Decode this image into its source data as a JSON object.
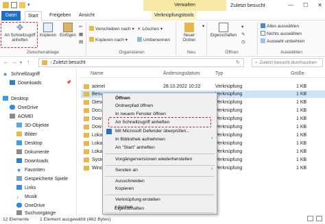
{
  "window": {
    "title": "Zuletzt besucht",
    "context_tab_group": "Verwalten",
    "controls": [
      "—",
      "☐",
      "✕"
    ]
  },
  "tabs": [
    "Datei",
    "Start",
    "Freigeben",
    "Ansicht",
    "Verknüpfungstools"
  ],
  "ribbon": {
    "pin_label": "An Schnellzugriff anheften",
    "copy_label": "Kopieren",
    "paste_label": "Einfügen",
    "group_clipboard": "Zwischenablage",
    "move_to": "Verschieben nach",
    "copy_to": "Kopieren nach",
    "delete": "Löschen",
    "rename": "Umbenennen",
    "group_organize": "Organisieren",
    "new_folder": "Neuer Ordner",
    "group_new": "Neu",
    "properties": "Eigenschaften",
    "group_open": "Öffnen",
    "select_all": "Alles auswählen",
    "select_none": "Nichts auswählen",
    "invert_selection": "Auswahl umkehren",
    "group_select": "Auswählen"
  },
  "address": {
    "path": "Zuletzt besucht",
    "search_placeholder": "Zuletzt besucht durchsuchen"
  },
  "nav": [
    {
      "label": "Schnellzugriff",
      "icon": "star-icon"
    },
    {
      "label": "Downloads",
      "icon": "download-icon"
    },
    {
      "label": "Desktop",
      "icon": "desktop-icon"
    },
    {
      "label": "OneDrive",
      "icon": "cloud-icon"
    },
    {
      "label": "AOMEI",
      "icon": "user-icon"
    },
    {
      "label": "3D-Objekte",
      "icon": "cube-icon"
    },
    {
      "label": "Bilder",
      "icon": "pictures-icon"
    },
    {
      "label": "Desktop",
      "icon": "desktop-icon"
    },
    {
      "label": "Dokumente",
      "icon": "documents-icon"
    },
    {
      "label": "Downloads",
      "icon": "download-icon"
    },
    {
      "label": "Favoriten",
      "icon": "favorites-icon"
    },
    {
      "label": "Gespeicherte Spiele",
      "icon": "games-icon"
    },
    {
      "label": "Links",
      "icon": "links-icon"
    },
    {
      "label": "Musik",
      "icon": "music-icon"
    },
    {
      "label": "OneDrive",
      "icon": "cloud-icon"
    },
    {
      "label": "Suchvorgänge",
      "icon": "search-icon"
    }
  ],
  "columns": [
    "Name",
    "Änderungsdatum",
    "Typ",
    "Größe"
  ],
  "rows": [
    {
      "name": "aomei",
      "date": "28.10.2022 10:22",
      "type": "Verknüpfung",
      "size": "1 KB"
    },
    {
      "name": "Benu",
      "date": "",
      "type": "Verknüpfung",
      "size": "1 KB"
    },
    {
      "name": "Diese",
      "date": "",
      "type": "Verknüpfung",
      "size": "1 KB"
    },
    {
      "name": "Docu",
      "date": "",
      "type": "Verknüpfung",
      "size": "1 KB"
    },
    {
      "name": "Dow",
      "date": "",
      "type": "Verknüpfung",
      "size": "1 KB"
    },
    {
      "name": "Dow",
      "date": "",
      "type": "Verknüpfung",
      "size": "1 KB"
    },
    {
      "name": "Loka",
      "date": "",
      "type": "Verknüpfung",
      "size": "1 KB"
    },
    {
      "name": "Loka",
      "date": "",
      "type": "Verknüpfung",
      "size": "1 KB"
    },
    {
      "name": "Loka",
      "date": "",
      "type": "Verknüpfung",
      "size": "1 KB"
    },
    {
      "name": "Syste",
      "date": "",
      "type": "Verknüpfung",
      "size": "1 KB"
    },
    {
      "name": "Wind",
      "date": "",
      "type": "Verknüpfung",
      "size": "1 KB"
    }
  ],
  "context_menu": {
    "open": "Öffnen",
    "open_location": "Ordnerpfad öffnen",
    "open_new_window": "In neuem Fenster öffnen",
    "pin_quick": "An Schnellzugriff anheften",
    "defender": "Mit Microsoft Defender überprüfen...",
    "include_library": "In Bibliothek aufnehmen",
    "pin_start": "An \"Start\" anheften",
    "restore_versions": "Vorgängerversionen wiederherstellen",
    "send_to": "Senden an",
    "cut": "Ausschneiden",
    "copy": "Kopieren",
    "create_shortcut": "Verknüpfung erstellen",
    "delete": "Löschen",
    "properties": "Eigenschaften"
  },
  "status": {
    "count": "12 Elemente",
    "selected": "1 Element ausgewählt (482 Bytes)"
  },
  "colors": {
    "accent": "#1d6ec9",
    "highlight": "#d6202a",
    "selection": "#cde6f7"
  }
}
